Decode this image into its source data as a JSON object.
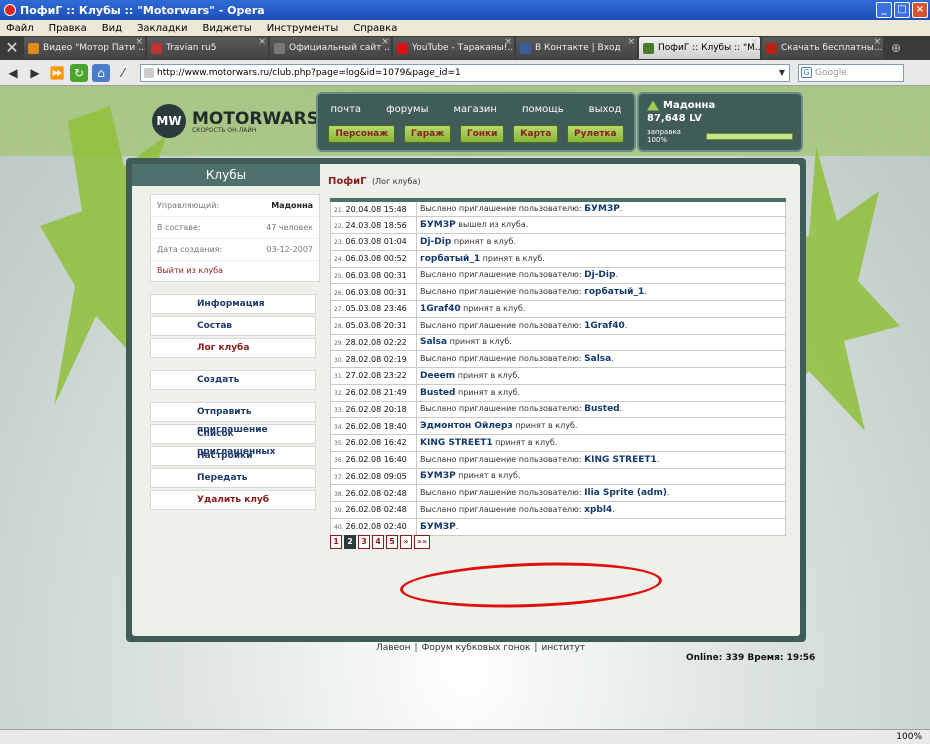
{
  "window": {
    "title": "ПофиГ :: Клубы :: \"Motorwars\" - Opera"
  },
  "menu": [
    "Файл",
    "Правка",
    "Вид",
    "Закладки",
    "Виджеты",
    "Инструменты",
    "Справка"
  ],
  "tabs": [
    {
      "label": "Видео \"Мотор Пати ...",
      "color": "#e08a1a",
      "active": false
    },
    {
      "label": "Travian ru5",
      "color": "#b33",
      "active": false
    },
    {
      "label": "Официальный сайт ...",
      "color": "#777",
      "active": false
    },
    {
      "label": "YouTube - Тараканы!...",
      "color": "#d11",
      "active": false
    },
    {
      "label": "В Контакте | Вход",
      "color": "#3b5f9b",
      "active": false
    },
    {
      "label": "ПофиГ :: Клубы :: \"M...",
      "color": "#4a7a2a",
      "active": true
    },
    {
      "label": "Скачать бесплатны...",
      "color": "#b21",
      "active": false
    }
  ],
  "address": {
    "url": "http://www.motorwars.ru/club.php?page=log&id=1079&page_id=1",
    "search_placeholder": "Google"
  },
  "site": {
    "brand": "MOTORWARS.RU",
    "slogan": "СКОРОСТЬ ОН-ЛАЙН",
    "logo_mark": "MW",
    "nav_links": [
      "почта",
      "форумы",
      "магазин",
      "помощь",
      "выход"
    ],
    "nav_buttons": [
      "Персонаж",
      "Гараж",
      "Гонки",
      "Карта",
      "Рулетка"
    ],
    "user": {
      "name": "Мадонна",
      "money": "87,648 LV",
      "fuel_label": "заправка 100%",
      "fuel": 1.0
    }
  },
  "sidebar": {
    "title": "Клубы",
    "info": [
      {
        "k": "Управляющий:",
        "v": "Мадонна"
      },
      {
        "k": "В составе:",
        "v": "47 человек"
      },
      {
        "k": "Дата создания:",
        "v": "03-12-2007"
      }
    ],
    "leave": "Выйти из клуба",
    "menu1": [
      "Информация",
      "Состав",
      "Лог клуба"
    ],
    "menu2": [
      "Создать"
    ],
    "menu3": [
      "Отправить приглашение",
      "Список приглашенных",
      "Настройки",
      "Передать",
      "Удалить клуб"
    ]
  },
  "log": {
    "club": "ПофиГ",
    "subtitle": "(Лог клуба)",
    "rows": [
      {
        "n": "21.",
        "date": "20.04.08 15:48",
        "pre": "Выслано приглашение пользователю: ",
        "name": "БУМЗР",
        "post": "."
      },
      {
        "n": "22.",
        "date": "24.03.08 18:56",
        "pre": "",
        "name": "БУМЗР",
        "post": " вышел из клуба."
      },
      {
        "n": "23.",
        "date": "06.03.08 01:04",
        "pre": "",
        "name": "Dj-Dip",
        "post": " принят в клуб."
      },
      {
        "n": "24.",
        "date": "06.03.08 00:52",
        "pre": "",
        "name": "горбатый_1",
        "post": " принят в клуб."
      },
      {
        "n": "25.",
        "date": "06.03.08 00:31",
        "pre": "Выслано приглашение пользователю: ",
        "name": "Dj-Dip",
        "post": "."
      },
      {
        "n": "26.",
        "date": "06.03.08 00:31",
        "pre": "Выслано приглашение пользователю: ",
        "name": "горбатый_1",
        "post": "."
      },
      {
        "n": "27.",
        "date": "05.03.08 23:46",
        "pre": "",
        "name": "1Graf40",
        "post": " принят в клуб."
      },
      {
        "n": "28.",
        "date": "05.03.08 20:31",
        "pre": "Выслано приглашение пользователю: ",
        "name": "1Graf40",
        "post": "."
      },
      {
        "n": "29.",
        "date": "28.02.08 02:22",
        "pre": "",
        "name": "Salsa",
        "post": " принят в клуб."
      },
      {
        "n": "30.",
        "date": "28.02.08 02:19",
        "pre": "Выслано приглашение пользователю: ",
        "name": "Salsa",
        "post": "."
      },
      {
        "n": "31.",
        "date": "27.02.08 23:22",
        "pre": "",
        "name": "Deeem",
        "post": " принят в клуб."
      },
      {
        "n": "32.",
        "date": "26.02.08 21:49",
        "pre": "",
        "name": "Busted",
        "post": " принят в клуб."
      },
      {
        "n": "33.",
        "date": "26.02.08 20:18",
        "pre": "Выслано приглашение пользователю: ",
        "name": "Busted",
        "post": "."
      },
      {
        "n": "34.",
        "date": "26.02.08 18:40",
        "pre": "",
        "name": "Эдмонтон Ойлерз",
        "post": " принят в клуб."
      },
      {
        "n": "35.",
        "date": "26.02.08 16:42",
        "pre": "",
        "name": "KING STREET1",
        "post": " принят в клуб."
      },
      {
        "n": "36.",
        "date": "26.02.08 16:40",
        "pre": "Выслано приглашение пользователю: ",
        "name": "KING STREET1",
        "post": "."
      },
      {
        "n": "37.",
        "date": "26.02.08 09:05",
        "pre": "",
        "name": "БУМЗР",
        "post": " принят в клуб."
      },
      {
        "n": "38.",
        "date": "26.02.08 02:48",
        "pre": "Выслано приглашение пользователю: ",
        "name": "Ilia Sprite (adm)",
        "post": "."
      },
      {
        "n": "39.",
        "date": "26.02.08 02:48",
        "pre": "Выслано приглашение пользователю: ",
        "name": "xpbl4",
        "post": "."
      },
      {
        "n": "40.",
        "date": "26.02.08 02:40",
        "pre": "",
        "name": "БУМЗР",
        "post": "."
      }
    ],
    "pages": [
      "1",
      "2",
      "3",
      "4",
      "5",
      "»",
      "»»"
    ],
    "current_page": "2"
  },
  "footer": {
    "links": [
      "Лавеон",
      "Форум кубковых гонок",
      "институт"
    ],
    "online": "Online: 339  Время: 19:56"
  },
  "statusbar": {
    "zoom": "100%"
  }
}
